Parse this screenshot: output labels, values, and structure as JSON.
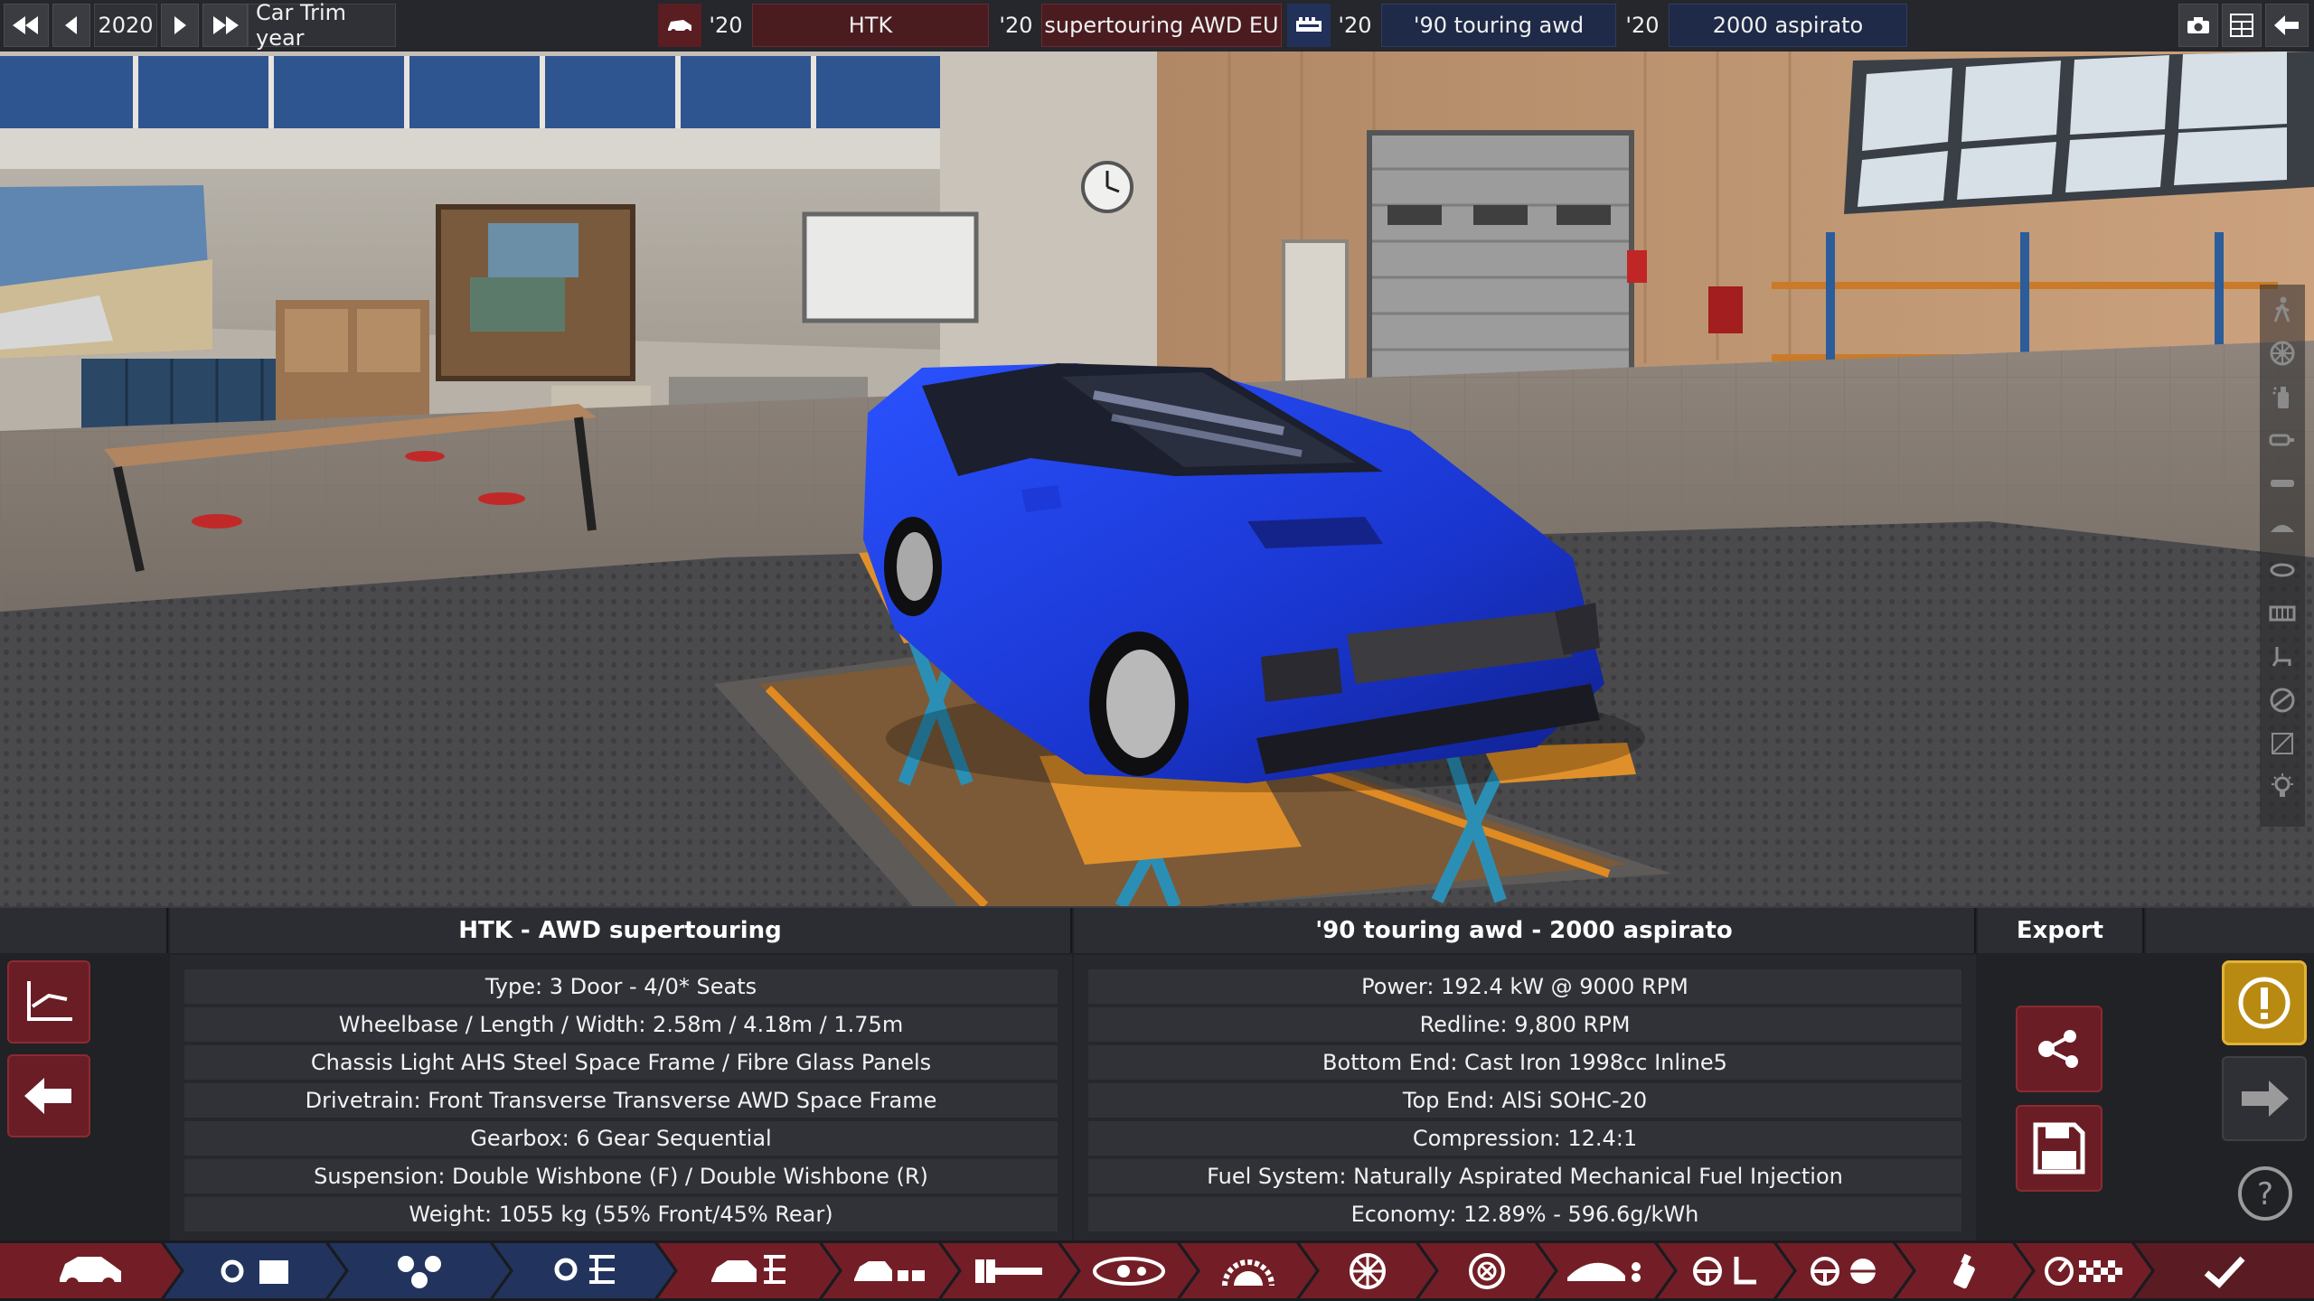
{
  "top_bar": {
    "rewind_icon": "fast-rewind-icon",
    "prev_icon": "previous-icon",
    "year": "2020",
    "next_icon": "play-next-icon",
    "fast_forward_icon": "fast-forward-icon",
    "label": "Car Trim year",
    "car_icon": "car-icon",
    "car_model_year": "'20",
    "car_model": "HTK",
    "trim_year": "'20",
    "trim": "supertouring AWD EU",
    "engine_icon": "engine-block-icon",
    "engine_family_year": "'20",
    "engine_family": "'90 touring awd",
    "variant_year": "'20",
    "variant": "2000 aspirato",
    "camera_icon": "camera-icon",
    "layout_icon": "layout-grid-icon",
    "back_icon": "back-arrow-icon"
  },
  "side_tools": [
    "walking-person-icon",
    "wheel-icon",
    "spray-icon",
    "exhaust-icon",
    "bumper-icon",
    "car-roof-icon",
    "lights-icon",
    "grille-icon",
    "seat-icon",
    "steering-icon",
    "frame-icon",
    "bulb-icon"
  ],
  "car_panel": {
    "title": "HTK - AWD supertouring",
    "rows": [
      "Type: 3 Door - 4/0* Seats",
      "Wheelbase / Length / Width: 2.58m / 4.18m / 1.75m",
      "Chassis Light AHS Steel Space Frame / Fibre Glass Panels",
      "Drivetrain: Front Transverse Transverse AWD Space Frame",
      "Gearbox: 6 Gear Sequential",
      "Suspension: Double Wishbone (F) / Double Wishbone (R)",
      "Weight: 1055 kg (55% Front/45% Rear)"
    ]
  },
  "engine_panel": {
    "title": "'90 touring awd - 2000 aspirato",
    "rows": [
      "Power: 192.4 kW @ 9000 RPM",
      "Redline:  9,800 RPM",
      "Bottom End: Cast Iron 1998cc Inline5",
      "Top End: AlSi SOHC-20",
      "Compression: 12.4:1",
      "Fuel System: Naturally Aspirated Mechanical Fuel Injection",
      "Economy: 12.89% - 596.6g/kWh"
    ]
  },
  "export_panel": {
    "title": "Export",
    "share_icon": "share-icon",
    "save_icon": "save-floppy-icon"
  },
  "left_buttons": {
    "chart_icon": "graph-axis-icon",
    "back_icon": "left-arrow-icon"
  },
  "right_buttons": {
    "warning_icon": "warning-exclamation-icon",
    "next_icon": "right-arrow-icon",
    "help_icon": "help-question-icon"
  },
  "bottom_nav": [
    {
      "icon": "car-model-icon",
      "style": "red"
    },
    {
      "icon": "engine-family-icon",
      "style": "navy"
    },
    {
      "icon": "engine-parts-icon",
      "style": "navy"
    },
    {
      "icon": "engine-tuning-icon",
      "style": "navy"
    },
    {
      "icon": "car-trim-icon",
      "style": "red"
    },
    {
      "icon": "body-icon",
      "style": "red"
    },
    {
      "icon": "chassis-icon",
      "style": "red"
    },
    {
      "icon": "drivetrain-icon",
      "style": "red"
    },
    {
      "icon": "suspension-icon",
      "style": "red"
    },
    {
      "icon": "wheels-icon",
      "style": "red"
    },
    {
      "icon": "brakes-icon",
      "style": "red"
    },
    {
      "icon": "aero-icon",
      "style": "red"
    },
    {
      "icon": "interior-icon",
      "style": "red"
    },
    {
      "icon": "tuning-icon",
      "style": "red"
    },
    {
      "icon": "paint-icon",
      "style": "red"
    },
    {
      "icon": "test-track-icon",
      "style": "red"
    },
    {
      "icon": "checkmark-icon",
      "style": "dark"
    }
  ]
}
